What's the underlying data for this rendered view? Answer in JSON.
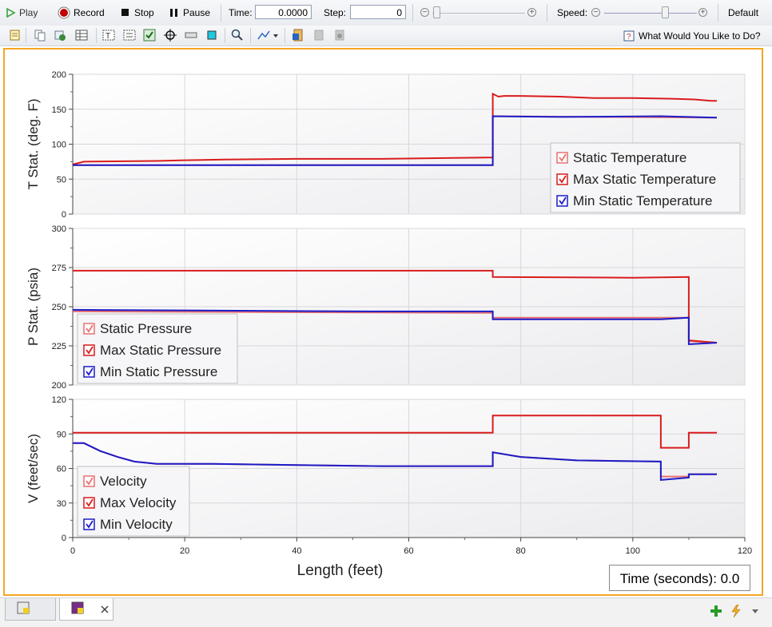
{
  "toolbar": {
    "play_label": "Play",
    "record_label": "Record",
    "stop_label": "Stop",
    "pause_label": "Pause",
    "time_label": "Time:",
    "time_value": "0.0000",
    "step_label": "Step:",
    "step_value": "0",
    "speed_label": "Speed:",
    "speed_value": "Default",
    "help_label": "What Would You Like to Do?"
  },
  "chart_data": [
    {
      "type": "line",
      "ylabel": "T Stat. (deg. F)",
      "xlim": [
        0,
        120
      ],
      "ylim": [
        0,
        200
      ],
      "y_ticks": [
        0,
        50,
        100,
        150,
        200
      ],
      "legend_position": "right",
      "series": [
        {
          "name": "Static Temperature",
          "color": "#e87070",
          "x": [
            0,
            75,
            75,
            115
          ],
          "y": [
            70,
            70,
            140,
            138
          ]
        },
        {
          "name": "Max Static Temperature",
          "color": "#d91c1c",
          "x": [
            0,
            2,
            15,
            20,
            27,
            40,
            55,
            65,
            75,
            75,
            76,
            77,
            80,
            87,
            93,
            100,
            107,
            111,
            114,
            115
          ],
          "y": [
            71,
            75,
            76,
            77,
            78,
            79,
            79,
            80,
            81,
            172,
            168,
            169,
            169,
            168,
            166,
            166,
            165,
            164,
            162,
            162
          ]
        },
        {
          "name": "Min Static Temperature",
          "color": "#1c1cc8",
          "x": [
            0,
            75,
            75,
            87,
            105,
            115
          ],
          "y": [
            70,
            70,
            140,
            139,
            140,
            138
          ]
        }
      ]
    },
    {
      "type": "line",
      "ylabel": "P Stat. (psia)",
      "xlim": [
        0,
        120
      ],
      "ylim": [
        200,
        300
      ],
      "y_ticks": [
        200,
        225,
        250,
        275,
        300
      ],
      "legend_position": "bottom-left",
      "series": [
        {
          "name": "Static Pressure",
          "color": "#e87070",
          "x": [
            0,
            75,
            75,
            110,
            110,
            115
          ],
          "y": [
            247,
            246,
            243,
            243,
            228,
            227
          ]
        },
        {
          "name": "Max Static Pressure",
          "color": "#d91c1c",
          "x": [
            0,
            44,
            75,
            75,
            100,
            110,
            110,
            115
          ],
          "y": [
            273,
            273,
            273,
            269,
            268.5,
            269,
            228.5,
            227
          ]
        },
        {
          "name": "Min Static Pressure",
          "color": "#1c1cc8",
          "x": [
            0,
            53,
            75,
            75,
            105,
            110,
            110,
            115
          ],
          "y": [
            248,
            247,
            247,
            242,
            242,
            243,
            226,
            227
          ]
        }
      ]
    },
    {
      "type": "line",
      "ylabel": "V (feet/sec)",
      "xlabel": "Length (feet)",
      "xlim": [
        0,
        120
      ],
      "ylim": [
        0,
        120
      ],
      "x_ticks": [
        0,
        20,
        40,
        60,
        80,
        100,
        120
      ],
      "y_ticks": [
        0,
        30,
        60,
        90,
        120
      ],
      "legend_position": "bottom-left",
      "series": [
        {
          "name": "Velocity",
          "color": "#e87070",
          "x": [
            0,
            2,
            5,
            8,
            11,
            15,
            25,
            40,
            55,
            75,
            75,
            80,
            90,
            105,
            105,
            110,
            110,
            115
          ],
          "y": [
            82,
            82,
            75,
            70,
            66,
            64,
            64,
            63,
            62,
            62,
            74,
            70,
            67,
            66,
            53,
            53,
            55,
            55
          ]
        },
        {
          "name": "Max Velocity",
          "color": "#d91c1c",
          "x": [
            0,
            75,
            75,
            105,
            105,
            110,
            110,
            115
          ],
          "y": [
            91,
            91,
            106,
            106,
            78,
            78,
            91,
            91
          ]
        },
        {
          "name": "Min Velocity",
          "color": "#1c1cc8",
          "x": [
            0,
            2,
            5,
            8,
            11,
            15,
            25,
            40,
            55,
            75,
            75,
            80,
            90,
            105,
            105,
            110,
            110,
            115
          ],
          "y": [
            82,
            82,
            75,
            70,
            66,
            64,
            64,
            63,
            62,
            62,
            74,
            70,
            67,
            66,
            50,
            52,
            55,
            55
          ]
        }
      ]
    }
  ],
  "time_box": "Time (seconds): 0.0"
}
